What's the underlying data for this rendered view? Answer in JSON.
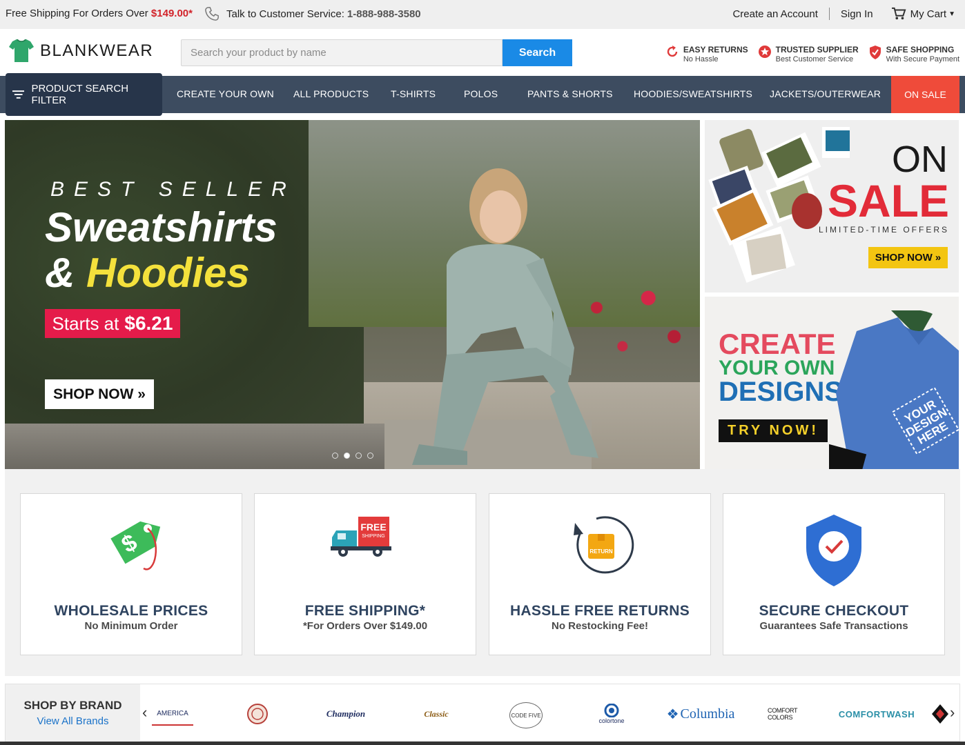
{
  "topbar": {
    "shipping_text": "Free Shipping For Orders Over",
    "shipping_price": "$149.00*",
    "phone_label": "Talk to Customer Service:",
    "phone_number": "1-888-988-3580",
    "create_account": "Create an Account",
    "sign_in": "Sign In",
    "cart": "My Cart"
  },
  "header": {
    "logo_text": "BLANKWEAR",
    "search_placeholder": "Search your product by name",
    "search_button": "Search",
    "badges": [
      {
        "title": "EASY RETURNS",
        "sub": "No Hassle",
        "icon": "return-arrow-icon",
        "color": "#e03a3a"
      },
      {
        "title": "TRUSTED SUPPLIER",
        "sub": "Best Customer Service",
        "icon": "star-badge-icon",
        "color": "#e03a3a"
      },
      {
        "title": "SAFE SHOPPING",
        "sub": "With Secure Payment",
        "icon": "shield-check-icon",
        "color": "#e03a3a"
      }
    ]
  },
  "nav": {
    "filter_label": "PRODUCT SEARCH FILTER",
    "items": [
      "CREATE YOUR OWN",
      "ALL PRODUCTS",
      "T-SHIRTS",
      "POLOS",
      "PANTS & SHORTS",
      "HOODIES/SWEATSHIRTS",
      "JACKETS/OUTERWEAR"
    ],
    "sale": "ON SALE",
    "colors": {
      "bar": "#3d4c60",
      "filter": "#27354a",
      "sale": "#ef4b3a"
    }
  },
  "hero": {
    "kicker": "BEST SELLER",
    "line1": "Sweatshirts",
    "line2_amp": "&",
    "line2_word": "Hoodies",
    "starts_text": "Starts at",
    "starts_price": "$6.21",
    "shop_now": "SHOP NOW »",
    "slide_count": 4,
    "active_slide": 2
  },
  "side_banners": {
    "sale": {
      "on": "ON",
      "sale": "SALE",
      "tagline": "LIMITED-TIME OFFERS",
      "button": "SHOP NOW »"
    },
    "create": {
      "line1": "CREATE",
      "line2": "YOUR OWN",
      "line3": "DESIGNS",
      "button": "TRY NOW!",
      "shirt_text": "YOUR DESIGN HERE"
    }
  },
  "features": [
    {
      "title": "WHOLESALE PRICES",
      "sub": "No Minimum Order",
      "icon": "price-tag-icon"
    },
    {
      "title": "FREE SHIPPING*",
      "sub": "*For Orders Over $149.00",
      "icon": "delivery-truck-icon"
    },
    {
      "title": "HASSLE FREE RETURNS",
      "sub": "No Restocking Fee!",
      "icon": "return-box-icon"
    },
    {
      "title": "SECURE CHECKOUT",
      "sub": "Guarantees Safe Transactions",
      "icon": "shield-check-icon"
    }
  ],
  "truck_label": {
    "free": "FREE",
    "shipping": "SHIPPING"
  },
  "return_label": "RETURN",
  "brands": {
    "title": "SHOP BY BRAND",
    "view_all": "View All Brands",
    "logos": [
      "AMERICA",
      "Brand Seal",
      "Champion",
      "Classic",
      "CODE FIVE",
      "colortone",
      "Columbia",
      "COMFORT COLORS",
      "COMFORTWASH",
      "Brand Logo"
    ]
  }
}
